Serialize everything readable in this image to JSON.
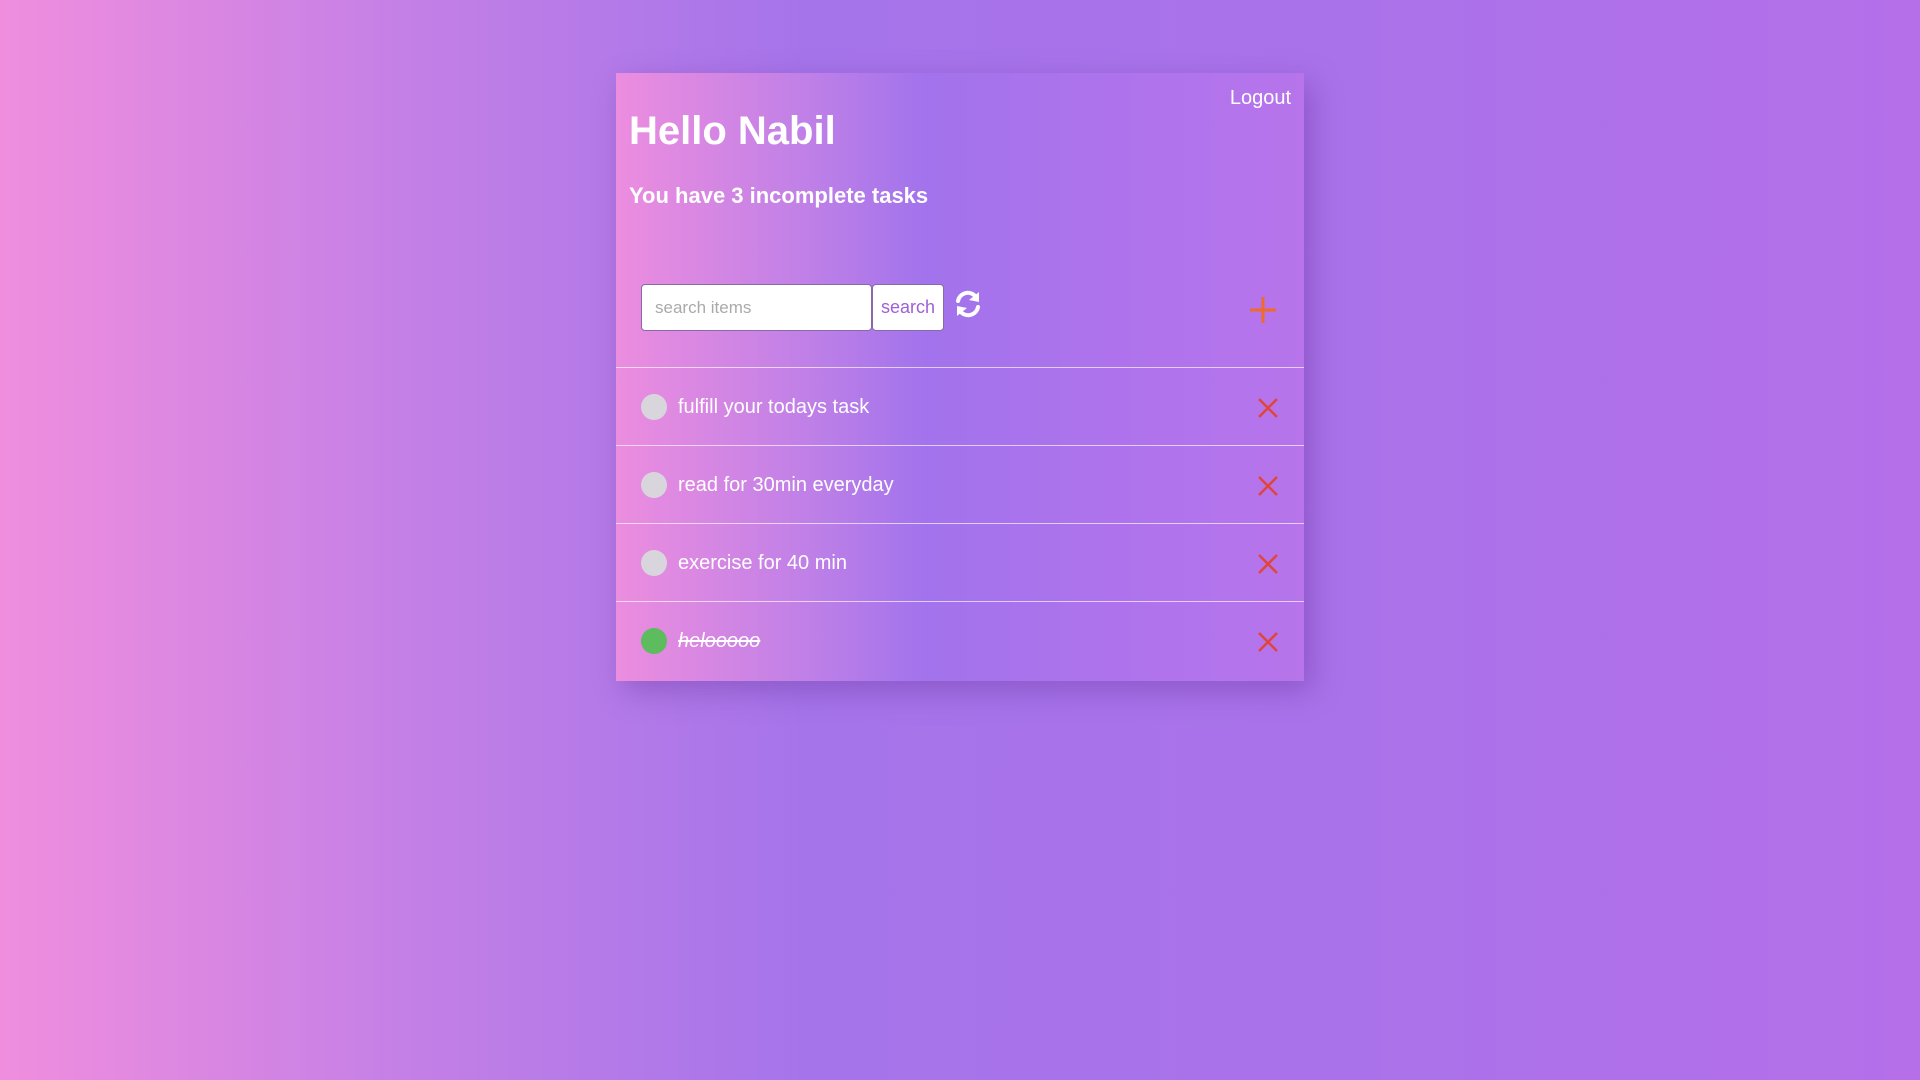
{
  "header": {
    "logout_label": "Logout",
    "greeting": "Hello Nabil",
    "subtitle": "You have 3 incomplete tasks"
  },
  "toolbar": {
    "search_placeholder": "search items",
    "search_value": "",
    "search_label": "search",
    "refresh_icon": "refresh-icon",
    "add_icon": "plus-icon"
  },
  "tasks": [
    {
      "text": "fulfill your todays task",
      "done": false
    },
    {
      "text": "read for 30min everyday",
      "done": false
    },
    {
      "text": "exercise for 40 min",
      "done": false
    },
    {
      "text": "helooooo",
      "done": true
    }
  ],
  "colors": {
    "accent": "#a05fd6",
    "delete": "#e0453a",
    "add": "#f06a2a",
    "done": "#5cbc5e",
    "pending": "#d8d6dc"
  }
}
